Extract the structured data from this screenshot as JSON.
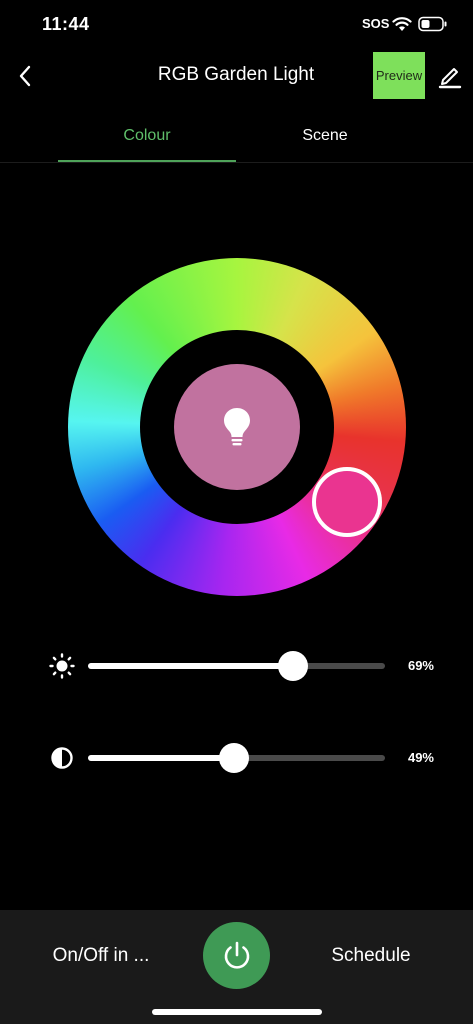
{
  "status_bar": {
    "time": "11:44",
    "sos": "SOS"
  },
  "header": {
    "title": "RGB Garden Light",
    "preview_label": "Preview"
  },
  "tabs": [
    {
      "label": "Colour",
      "active": true
    },
    {
      "label": "Scene",
      "active": false
    }
  ],
  "colour": {
    "selected_color": "#ea3490",
    "preview_color": "#c1729f"
  },
  "sliders": {
    "brightness": {
      "value": 69,
      "label": "69%"
    },
    "saturation": {
      "value": 49,
      "label": "49%"
    }
  },
  "bottom_bar": {
    "left_label": "On/Off in ...",
    "right_label": "Schedule"
  },
  "colors": {
    "accent": "#5fbf6a",
    "preview_button": "#7ee05b",
    "power_button": "#3f9a55"
  }
}
